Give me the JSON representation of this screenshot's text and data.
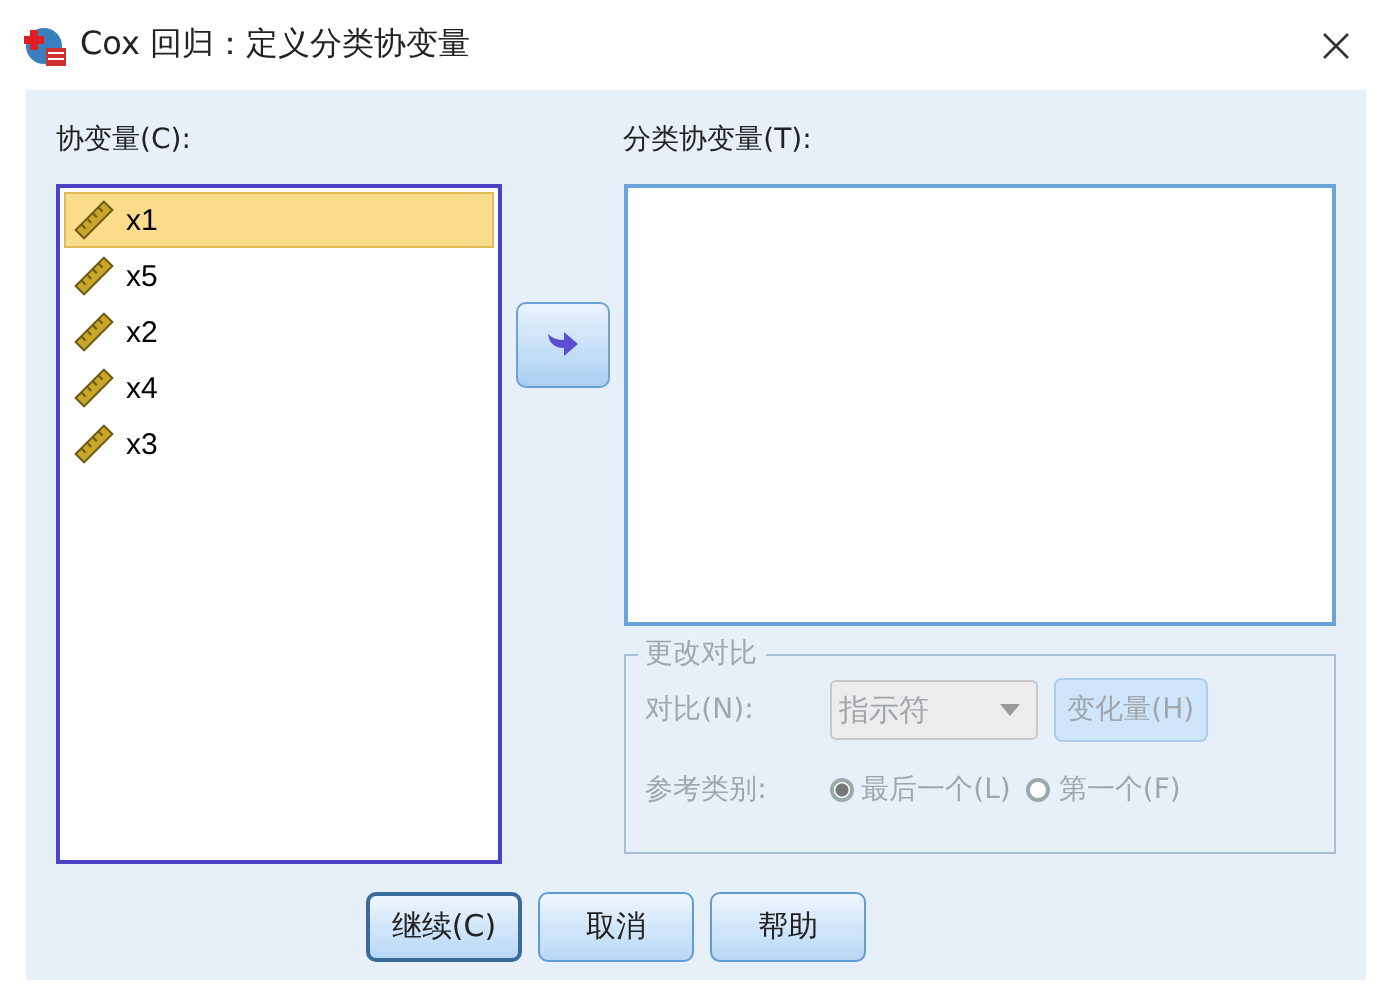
{
  "window": {
    "title": "Cox 回归：定义分类协变量"
  },
  "covariates": {
    "label": "协变量(C):",
    "items": [
      {
        "name": "x1",
        "selected": true
      },
      {
        "name": "x5",
        "selected": false
      },
      {
        "name": "x2",
        "selected": false
      },
      {
        "name": "x4",
        "selected": false
      },
      {
        "name": "x3",
        "selected": false
      }
    ]
  },
  "categorical": {
    "label": "分类协变量(T):"
  },
  "change_contrast": {
    "title": "更改对比",
    "disabled": true,
    "contrast_label": "对比(N):",
    "contrast_value": "指示符",
    "change_button": "变化量(H)",
    "reference_label": "参考类别:",
    "options": [
      {
        "label": "最后一个(L)",
        "selected": true
      },
      {
        "label": "第一个(F)",
        "selected": false
      }
    ]
  },
  "buttons": [
    {
      "label": "继续(C)",
      "default": true
    },
    {
      "label": "取消",
      "default": false
    },
    {
      "label": "帮助",
      "default": false
    }
  ]
}
